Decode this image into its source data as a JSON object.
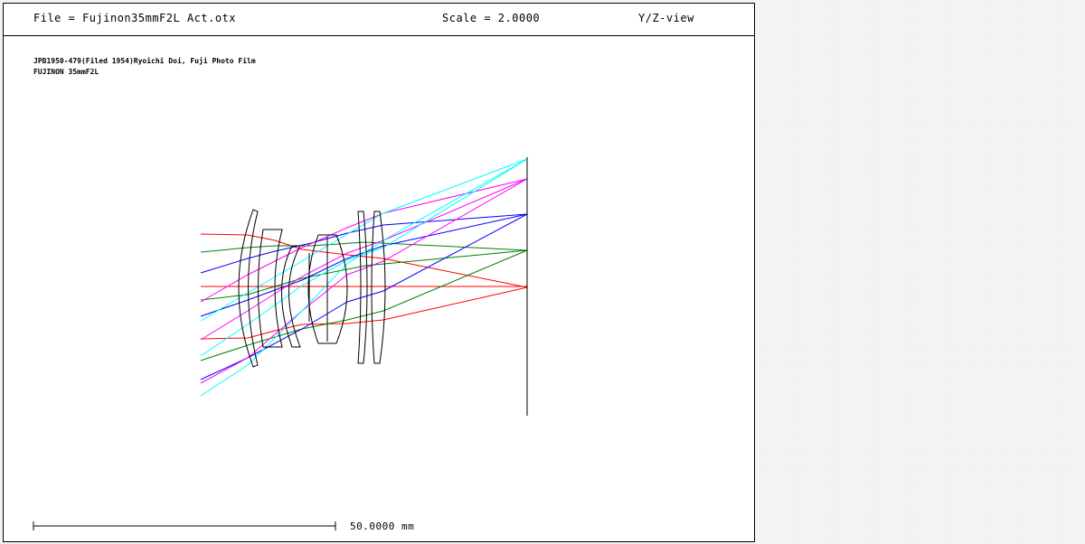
{
  "header": {
    "file_label": "File = Fujinon35mmF2L Act.otx",
    "scale_label": "Scale = 2.0000",
    "view_label": "Y/Z-view"
  },
  "description": {
    "line1": "JPB1950-479(Filed 1954)Ryoichi Doi, Fuji Photo Film",
    "line2": "FUJINON 35mmF2L"
  },
  "scale_bar": {
    "label": "50.0000 mm"
  },
  "ray_colors": {
    "field_0": "#ff0000",
    "field_1": "#008000",
    "field_2": "#0000ff",
    "field_3": "#ff00ff",
    "field_4": "#00ffff"
  },
  "lens_color": "#000000"
}
